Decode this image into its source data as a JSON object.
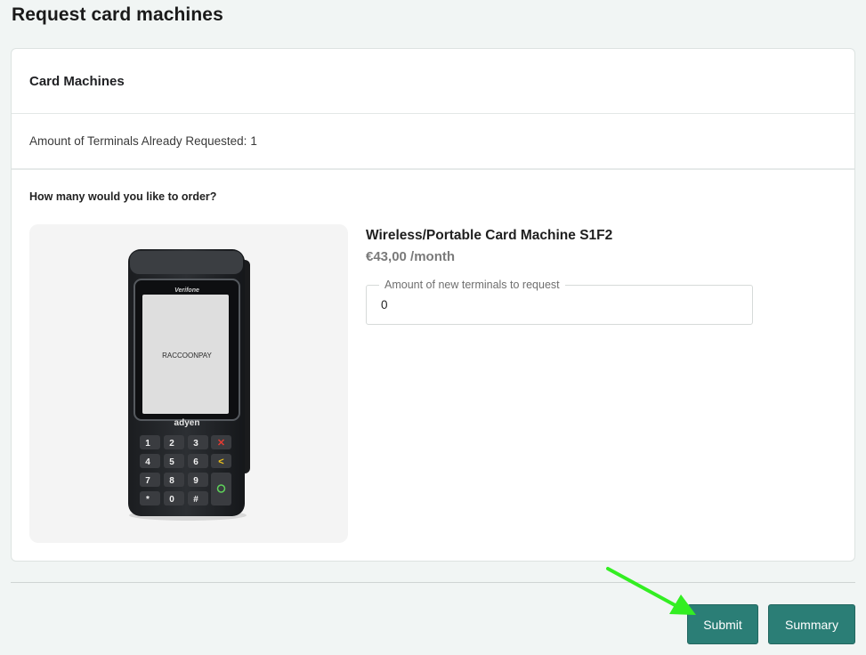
{
  "page": {
    "title": "Request card machines"
  },
  "card": {
    "header": "Card Machines",
    "info_label": "Amount of Terminals Already Requested:",
    "info_value": "1",
    "question": "How many would you like to order?"
  },
  "product": {
    "name": "Wireless/Portable Card Machine S1F2",
    "price": "€43,00 /month",
    "image": {
      "brand_top": "Verifone",
      "screen_brand": "RACCOONPAY",
      "brand_bottom": "adyen",
      "keys": [
        "1",
        "2",
        "3",
        "4",
        "5",
        "6",
        "7",
        "8",
        "9",
        "*",
        "0",
        "#"
      ]
    },
    "quantity_field": {
      "label": "Amount of new terminals to request",
      "value": "0"
    }
  },
  "actions": {
    "submit_label": "Submit",
    "summary_label": "Summary"
  },
  "colors": {
    "primary": "#2b7e76",
    "annotation_arrow": "#33ee22",
    "background": "#f1f5f4"
  }
}
